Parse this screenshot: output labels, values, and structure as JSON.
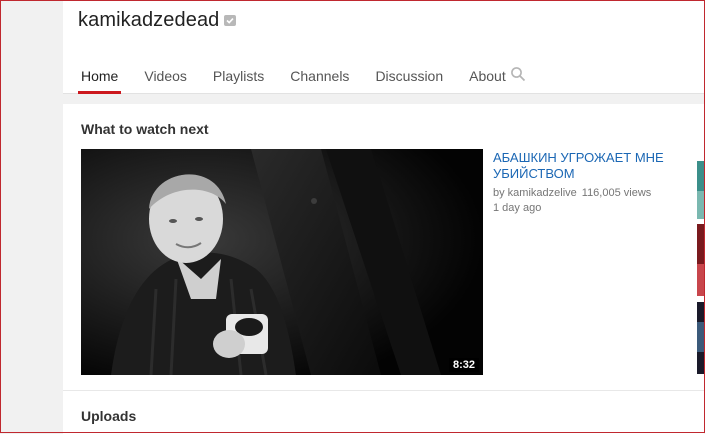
{
  "channel": {
    "title": "kamikadzedead"
  },
  "nav": {
    "tabs": [
      {
        "label": "Home",
        "active": true
      },
      {
        "label": "Videos"
      },
      {
        "label": "Playlists"
      },
      {
        "label": "Channels"
      },
      {
        "label": "Discussion"
      },
      {
        "label": "About"
      }
    ],
    "search_icon": "search-icon"
  },
  "featured": {
    "section_title": "What to watch next",
    "video": {
      "title": "АБАШКИН УГРОЖАЕТ МНЕ УБИЙСТВОМ",
      "owner": "by kamikadzelive",
      "views": "116,005 views",
      "age": "1 day ago",
      "duration": "8:32"
    }
  },
  "uploads": {
    "section_title": "Uploads"
  },
  "colors": {
    "accent_red": "#cc181e",
    "link_blue": "#1b67b4",
    "frame_border": "#c0282f"
  }
}
